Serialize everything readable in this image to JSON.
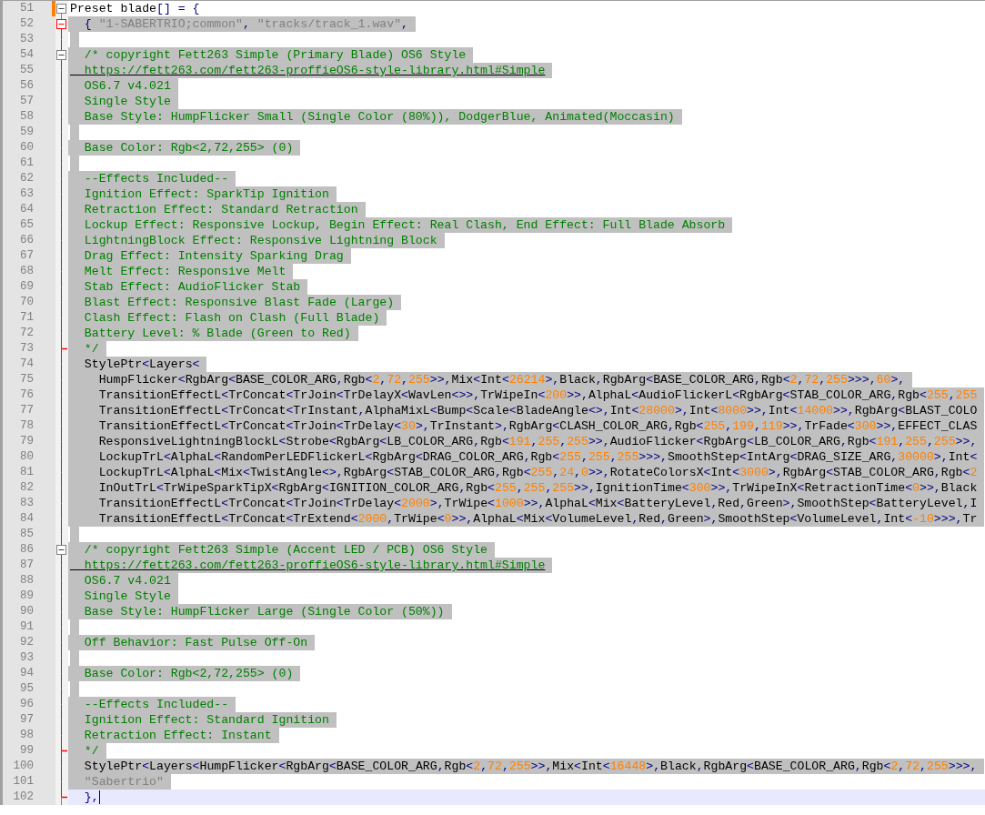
{
  "editor": {
    "lines": [
      {
        "number": "51",
        "text": "Preset blade[] = {",
        "kind": "code",
        "selected": false,
        "current": false,
        "changed": true,
        "fold": {
          "kind": "start",
          "highlight": false
        }
      },
      {
        "number": "52",
        "text": "  { \"1-SABERTRIO;common\", \"tracks/track_1.wav\",",
        "kind": "code",
        "selected": true,
        "current": false,
        "changed": false,
        "fold": {
          "kind": "start",
          "highlight": true
        }
      },
      {
        "number": "53",
        "kind": "blank",
        "selected": true,
        "current": false,
        "changed": false
      },
      {
        "number": "54",
        "text": "  /* copyright Fett263 Simple (Primary Blade) OS6 Style",
        "kind": "comment",
        "selected": true,
        "current": false,
        "changed": false,
        "fold": {
          "kind": "start",
          "highlight": false
        }
      },
      {
        "number": "55",
        "text": "  https://fett263.com/fett263-proffieOS6-style-library.html#Simple",
        "kind": "link",
        "selected": true,
        "current": false,
        "changed": false
      },
      {
        "number": "56",
        "text": "  OS6.7 v4.021",
        "kind": "comment",
        "selected": true,
        "current": false,
        "changed": false
      },
      {
        "number": "57",
        "text": "  Single Style",
        "kind": "comment",
        "selected": true,
        "current": false,
        "changed": false
      },
      {
        "number": "58",
        "text": "  Base Style: HumpFlicker Small (Single Color (80%)), DodgerBlue, Animated(Moccasin)",
        "kind": "comment",
        "selected": true,
        "current": false,
        "changed": false
      },
      {
        "number": "59",
        "kind": "blank",
        "selected": true,
        "current": false,
        "changed": false
      },
      {
        "number": "60",
        "text": "  Base Color: Rgb<2,72,255> (0)",
        "kind": "comment",
        "selected": true,
        "current": false,
        "changed": false
      },
      {
        "number": "61",
        "kind": "blank",
        "selected": true,
        "current": false,
        "changed": false
      },
      {
        "number": "62",
        "text": "  --Effects Included--",
        "kind": "comment",
        "selected": true,
        "current": false,
        "changed": false
      },
      {
        "number": "63",
        "text": "  Ignition Effect: SparkTip Ignition",
        "kind": "comment",
        "selected": true,
        "current": false,
        "changed": false
      },
      {
        "number": "64",
        "text": "  Retraction Effect: Standard Retraction",
        "kind": "comment",
        "selected": true,
        "current": false,
        "changed": false
      },
      {
        "number": "65",
        "text": "  Lockup Effect: Responsive Lockup, Begin Effect: Real Clash, End Effect: Full Blade Absorb",
        "kind": "comment",
        "selected": true,
        "current": false,
        "changed": false
      },
      {
        "number": "66",
        "text": "  LightningBlock Effect: Responsive Lightning Block",
        "kind": "comment",
        "selected": true,
        "current": false,
        "changed": false
      },
      {
        "number": "67",
        "text": "  Drag Effect: Intensity Sparking Drag",
        "kind": "comment",
        "selected": true,
        "current": false,
        "changed": false
      },
      {
        "number": "68",
        "text": "  Melt Effect: Responsive Melt",
        "kind": "comment",
        "selected": true,
        "current": false,
        "changed": false
      },
      {
        "number": "69",
        "text": "  Stab Effect: AudioFlicker Stab",
        "kind": "comment",
        "selected": true,
        "current": false,
        "changed": false
      },
      {
        "number": "70",
        "text": "  Blast Effect: Responsive Blast Fade (Large)",
        "kind": "comment",
        "selected": true,
        "current": false,
        "changed": false
      },
      {
        "number": "71",
        "text": "  Clash Effect: Flash on Clash (Full Blade)",
        "kind": "comment",
        "selected": true,
        "current": false,
        "changed": false
      },
      {
        "number": "72",
        "text": "  Battery Level: % Blade (Green to Red)",
        "kind": "comment",
        "selected": true,
        "current": false,
        "changed": false
      },
      {
        "number": "73",
        "text": "  */",
        "kind": "comment",
        "selected": true,
        "current": false,
        "changed": false,
        "fold": {
          "kind": "end"
        }
      },
      {
        "number": "74",
        "text": "  StylePtr<Layers<",
        "kind": "code",
        "selected": true,
        "current": false,
        "changed": false
      },
      {
        "number": "75",
        "text": "    HumpFlicker<RgbArg<BASE_COLOR_ARG,Rgb<2,72,255>>,Mix<Int<26214>,Black,RgbArg<BASE_COLOR_ARG,Rgb<2,72,255>>>,60>,",
        "kind": "code",
        "selected": true,
        "current": false,
        "changed": false
      },
      {
        "number": "76",
        "text": "    TransitionEffectL<TrConcat<TrJoin<TrDelayX<WavLen<>>,TrWipeIn<200>>,AlphaL<AudioFlickerL<RgbArg<STAB_COLOR_ARG,Rgb<255,255",
        "kind": "code",
        "selected": true,
        "current": false,
        "changed": false
      },
      {
        "number": "77",
        "text": "    TransitionEffectL<TrConcat<TrInstant,AlphaMixL<Bump<Scale<BladeAngle<>,Int<28000>,Int<8000>>,Int<14000>>,RgbArg<BLAST_COLO",
        "kind": "code",
        "selected": true,
        "current": false,
        "changed": false
      },
      {
        "number": "78",
        "text": "    TransitionEffectL<TrConcat<TrJoin<TrDelay<30>,TrInstant>,RgbArg<CLASH_COLOR_ARG,Rgb<255,199,119>>,TrFade<300>>,EFFECT_CLAS",
        "kind": "code",
        "selected": true,
        "current": false,
        "changed": false
      },
      {
        "number": "79",
        "text": "    ResponsiveLightningBlockL<Strobe<RgbArg<LB_COLOR_ARG,Rgb<191,255,255>>,AudioFlicker<RgbArg<LB_COLOR_ARG,Rgb<191,255,255>>,",
        "kind": "code",
        "selected": true,
        "current": false,
        "changed": false
      },
      {
        "number": "80",
        "text": "    LockupTrL<AlphaL<RandomPerLEDFlickerL<RgbArg<DRAG_COLOR_ARG,Rgb<255,255,255>>>,SmoothStep<IntArg<DRAG_SIZE_ARG,30000>,Int<",
        "kind": "code",
        "selected": true,
        "current": false,
        "changed": false
      },
      {
        "number": "81",
        "text": "    LockupTrL<AlphaL<Mix<TwistAngle<>,RgbArg<STAB_COLOR_ARG,Rgb<255,24,0>>,RotateColorsX<Int<3000>,RgbArg<STAB_COLOR_ARG,Rgb<2",
        "kind": "code",
        "selected": true,
        "current": false,
        "changed": false
      },
      {
        "number": "82",
        "text": "    InOutTrL<TrWipeSparkTipX<RgbArg<IGNITION_COLOR_ARG,Rgb<255,255,255>>,IgnitionTime<300>>,TrWipeInX<RetractionTime<0>>,Black",
        "kind": "code",
        "selected": true,
        "current": false,
        "changed": false
      },
      {
        "number": "83",
        "text": "    TransitionEffectL<TrConcat<TrJoin<TrDelay<2000>,TrWipe<1000>>,AlphaL<Mix<BatteryLevel,Red,Green>,SmoothStep<BatteryLevel,I",
        "kind": "code",
        "selected": true,
        "current": false,
        "changed": false
      },
      {
        "number": "84",
        "text": "    TransitionEffectL<TrConcat<TrExtend<2000,TrWipe<0>>,AlphaL<Mix<VolumeLevel,Red,Green>,SmoothStep<VolumeLevel,Int<-10>>>,Tr",
        "kind": "code",
        "selected": true,
        "current": false,
        "changed": false
      },
      {
        "number": "85",
        "kind": "blank",
        "selected": true,
        "current": false,
        "changed": false
      },
      {
        "number": "86",
        "text": "  /* copyright Fett263 Simple (Accent LED / PCB) OS6 Style",
        "kind": "comment",
        "selected": true,
        "current": false,
        "changed": false,
        "fold": {
          "kind": "start",
          "highlight": false
        }
      },
      {
        "number": "87",
        "text": "  https://fett263.com/fett263-proffieOS6-style-library.html#Simple",
        "kind": "link",
        "selected": true,
        "current": false,
        "changed": false
      },
      {
        "number": "88",
        "text": "  OS6.7 v4.021",
        "kind": "comment",
        "selected": true,
        "current": false,
        "changed": false
      },
      {
        "number": "89",
        "text": "  Single Style",
        "kind": "comment",
        "selected": true,
        "current": false,
        "changed": false
      },
      {
        "number": "90",
        "text": "  Base Style: HumpFlicker Large (Single Color (50%))",
        "kind": "comment",
        "selected": true,
        "current": false,
        "changed": false
      },
      {
        "number": "91",
        "kind": "blank",
        "selected": true,
        "current": false,
        "changed": false
      },
      {
        "number": "92",
        "text": "  Off Behavior: Fast Pulse Off-On",
        "kind": "comment",
        "selected": true,
        "current": false,
        "changed": false
      },
      {
        "number": "93",
        "kind": "blank",
        "selected": true,
        "current": false,
        "changed": false
      },
      {
        "number": "94",
        "text": "  Base Color: Rgb<2,72,255> (0)",
        "kind": "comment",
        "selected": true,
        "current": false,
        "changed": false
      },
      {
        "number": "95",
        "kind": "blank",
        "selected": true,
        "current": false,
        "changed": false
      },
      {
        "number": "96",
        "text": "  --Effects Included--",
        "kind": "comment",
        "selected": true,
        "current": false,
        "changed": false
      },
      {
        "number": "97",
        "text": "  Ignition Effect: Standard Ignition",
        "kind": "comment",
        "selected": true,
        "current": false,
        "changed": false
      },
      {
        "number": "98",
        "text": "  Retraction Effect: Instant",
        "kind": "comment",
        "selected": true,
        "current": false,
        "changed": false
      },
      {
        "number": "99",
        "text": "  */",
        "kind": "comment",
        "selected": true,
        "current": false,
        "changed": false,
        "fold": {
          "kind": "end"
        }
      },
      {
        "number": "100",
        "text": "  StylePtr<Layers<HumpFlicker<RgbArg<BASE_COLOR_ARG,Rgb<2,72,255>>,Mix<Int<16448>,Black,RgbArg<BASE_COLOR_ARG,Rgb<2,72,255>>>,",
        "kind": "code",
        "selected": true,
        "current": false,
        "changed": false
      },
      {
        "number": "101",
        "text": "  \"Sabertrio\"",
        "kind": "code",
        "selected": true,
        "current": false,
        "changed": false
      },
      {
        "number": "102",
        "text": "  },",
        "kind": "code",
        "selected": false,
        "current": true,
        "changed": false,
        "fold": {
          "kind": "end"
        }
      }
    ]
  }
}
